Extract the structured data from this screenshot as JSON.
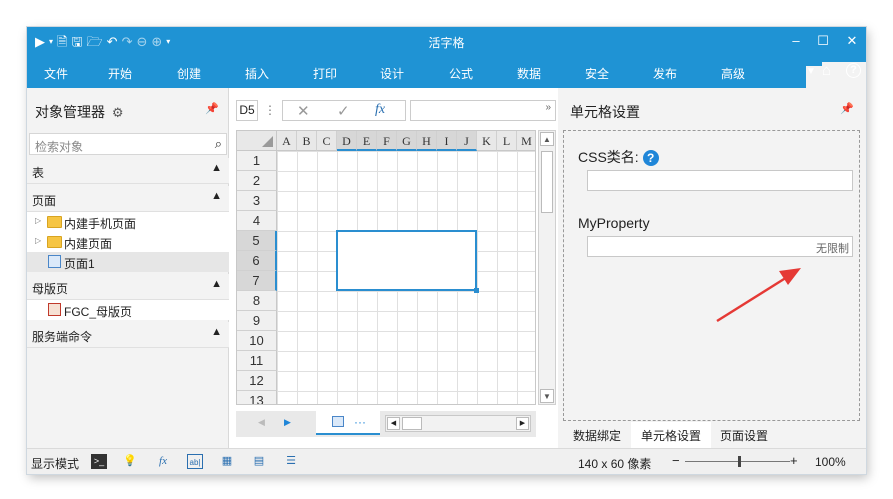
{
  "titlebar": {
    "title": "活字格",
    "quick_access": [
      "play-icon",
      "dropdown-icon",
      "new-file-icon",
      "save-icon",
      "open-folder-icon",
      "undo-icon",
      "redo-icon",
      "back-icon",
      "forward-icon",
      "customize-icon"
    ],
    "window_controls": {
      "minimize": "‒",
      "maximize": "☐",
      "close": "✕"
    }
  },
  "menubar": {
    "items": [
      "文件",
      "开始",
      "创建",
      "插入",
      "打印",
      "设计",
      "公式",
      "数据",
      "安全",
      "发布",
      "高级"
    ]
  },
  "left_panel": {
    "title": "对象管理器",
    "search_placeholder": "检索对象",
    "sections": {
      "table": "表",
      "page": "页面",
      "master": "母版页",
      "server": "服务端命令"
    },
    "page_items": [
      "内建手机页面",
      "内建页面",
      "页面1"
    ],
    "master_items": [
      "FGC_母版页"
    ]
  },
  "formula_bar": {
    "cell_ref": "D5",
    "fx_label": "fx",
    "cancel": "✕",
    "confirm": "✓"
  },
  "grid": {
    "columns": [
      "A",
      "B",
      "C",
      "D",
      "E",
      "F",
      "G",
      "H",
      "I",
      "J",
      "K",
      "L",
      "M"
    ],
    "rows": [
      "1",
      "2",
      "3",
      "4",
      "5",
      "6",
      "7",
      "8",
      "9",
      "10",
      "11",
      "12",
      "13"
    ],
    "selected_columns": [
      "D",
      "E",
      "F",
      "G",
      "H",
      "I",
      "J"
    ],
    "selected_rows": [
      "5",
      "6",
      "7"
    ],
    "selected_range": "D5:J7"
  },
  "right_panel": {
    "title": "单元格设置",
    "css_label": "CSS类名:",
    "css_value": "",
    "help_symbol": "?",
    "my_property_label": "MyProperty",
    "my_property_value": "无限制",
    "tabs": [
      "数据绑定",
      "单元格设置",
      "页面设置"
    ],
    "active_tab": "单元格设置"
  },
  "status": {
    "mode_label": "显示模式",
    "size_label": "140 x 60 像素",
    "zoom": "100%",
    "zoom_minus": "−",
    "zoom_plus": "+"
  },
  "colors": {
    "brand": "#1f93d4",
    "selection": "#2a8ed0",
    "annotation_arrow": "#e53935"
  }
}
